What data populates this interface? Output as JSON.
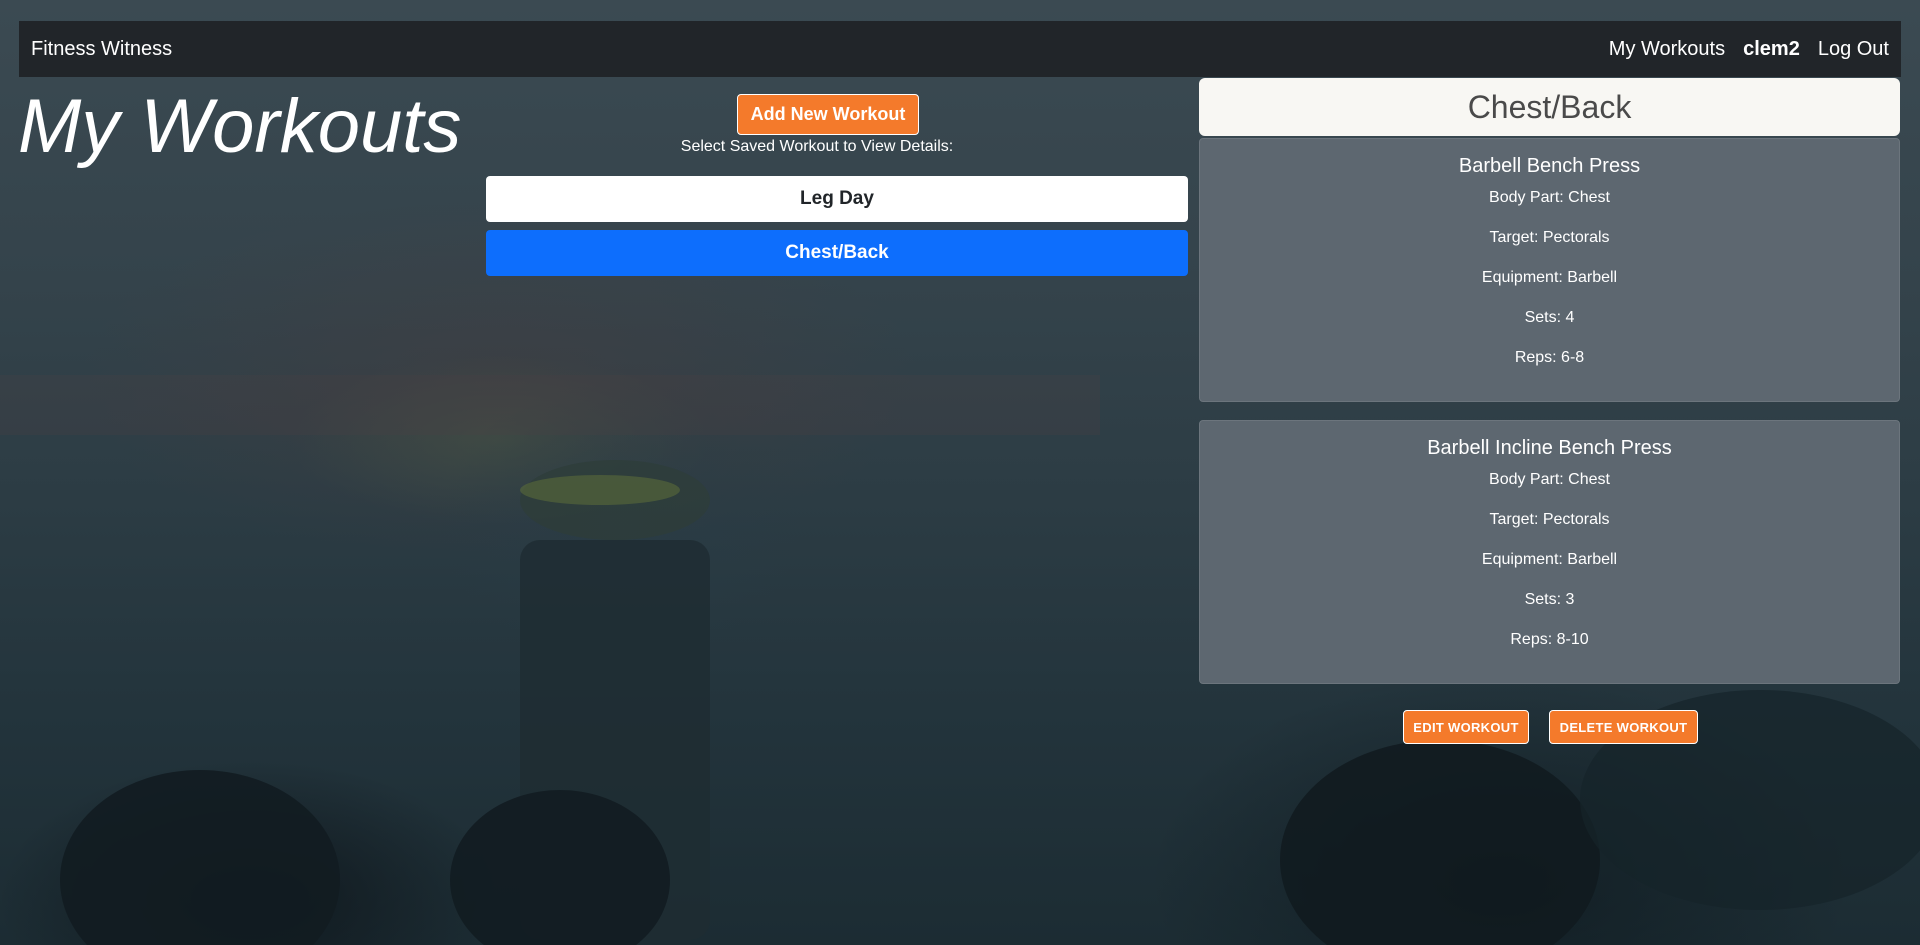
{
  "navbar": {
    "brand": "Fitness Witness",
    "links": [
      "My Workouts",
      "clem2",
      "Log Out"
    ]
  },
  "page_title": "My Workouts",
  "add_button_label": "Add New Workout",
  "select_label": "Select Saved Workout to View Details:",
  "workouts": [
    {
      "label": "Leg Day",
      "selected": false
    },
    {
      "label": "Chest/Back",
      "selected": true
    }
  ],
  "detail": {
    "title": "Chest/Back",
    "exercises": [
      {
        "name": "Barbell Bench Press",
        "body_part": "Body Part: Chest",
        "target": "Target: Pectorals",
        "equipment": "Equipment: Barbell",
        "sets": "Sets: 4",
        "reps": "Reps: 6-8"
      },
      {
        "name": "Barbell Incline Bench Press",
        "body_part": "Body Part: Chest",
        "target": "Target: Pectorals",
        "equipment": "Equipment: Barbell",
        "sets": "Sets: 3",
        "reps": "Reps: 8-10"
      }
    ]
  },
  "actions": {
    "edit_label": "EDIT WORKOUT",
    "delete_label": "DELETE WORKOUT"
  },
  "colors": {
    "accent": "#f47a2b",
    "selected": "#0d6efd",
    "navbar": "#212529",
    "card": "#5d6770"
  }
}
